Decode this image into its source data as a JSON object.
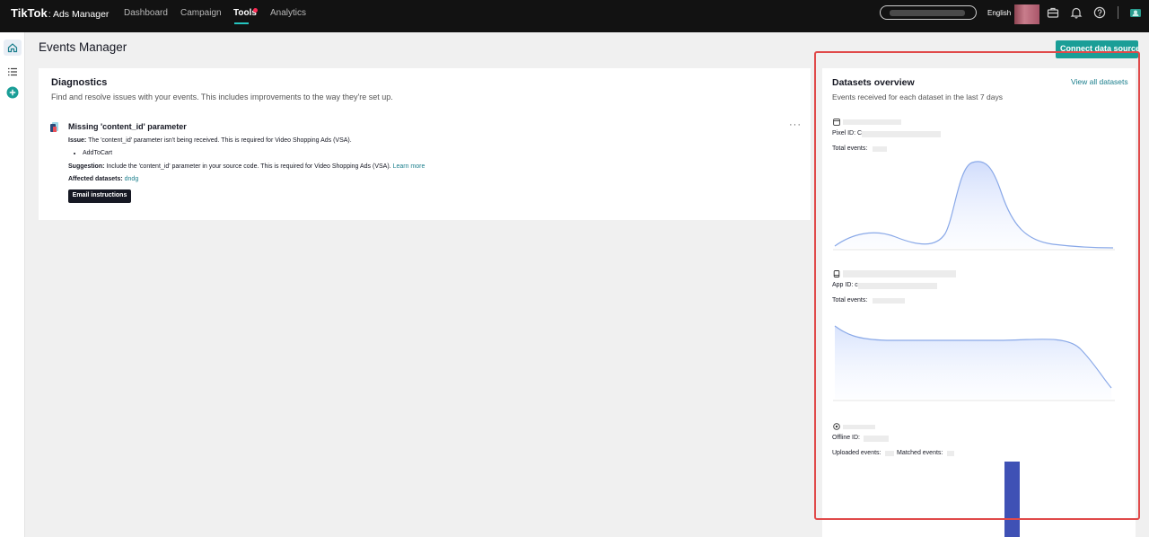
{
  "topbar": {
    "logo": "TikTok",
    "logo_sub": ": Ads Manager",
    "nav": [
      {
        "label": "Dashboard"
      },
      {
        "label": "Campaign"
      },
      {
        "label": "Tools"
      },
      {
        "label": "Analytics"
      }
    ],
    "language": "English",
    "icons": [
      "briefcase-icon",
      "bell-icon",
      "help-icon",
      "account-switch-icon"
    ]
  },
  "rail": {
    "icons": [
      "home-icon",
      "list-icon",
      "add-icon"
    ]
  },
  "page": {
    "title": "Events Manager",
    "connect_button": "Connect data source"
  },
  "diagnostics": {
    "title": "Diagnostics",
    "subtitle": "Find and resolve issues with your events. This includes improvements to the way they're set up.",
    "issue": {
      "title": "Missing 'content_id' parameter",
      "issue_label": "Issue:",
      "issue_text": "The 'content_id' parameter isn't being received. This is required for Video Shopping Ads (VSA).",
      "events": [
        "AddToCart"
      ],
      "suggestion_label": "Suggestion:",
      "suggestion_text": "Include the 'content_id' parameter in your source code. This is required for Video Shopping Ads (VSA).",
      "learn_more": "Learn more",
      "affected_label": "Affected datasets:",
      "affected_value": "dndg",
      "email_button": "Email instructions",
      "more": "···"
    }
  },
  "datasets": {
    "title": "Datasets overview",
    "subtitle": "Events received for each dataset in the last 7 days",
    "view_all": "View all datasets",
    "items": [
      {
        "id_label": "Pixel ID: C",
        "events_label": "Total events:"
      },
      {
        "id_label": "App ID: c",
        "events_label": "Total events:"
      },
      {
        "id_label": "Offline ID:",
        "uploaded_label": "Uploaded events:",
        "matched_label": "Matched events:"
      }
    ],
    "colors": {
      "line": "#8aa9e8",
      "bar": "#3f51b5"
    }
  }
}
